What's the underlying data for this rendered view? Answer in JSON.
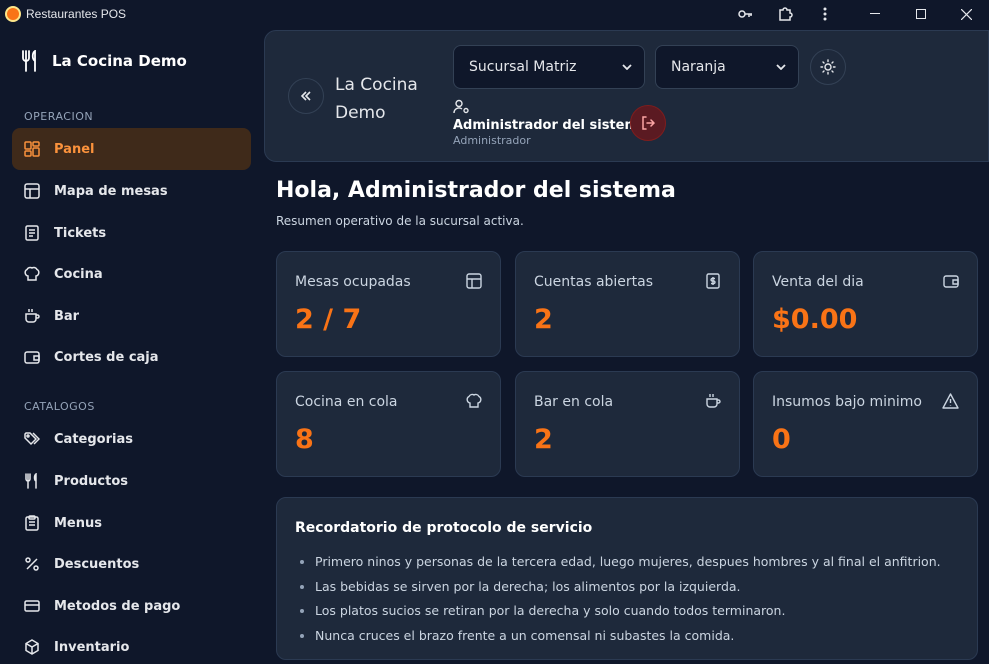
{
  "window": {
    "title": "Restaurantes POS"
  },
  "sidebar": {
    "brand": "La Cocina Demo",
    "sections": [
      {
        "label": "OPERACION",
        "items": [
          {
            "label": "Panel",
            "icon": "dashboard-icon",
            "active": true
          },
          {
            "label": "Mapa de mesas",
            "icon": "table-map-icon"
          },
          {
            "label": "Tickets",
            "icon": "ticket-icon"
          },
          {
            "label": "Cocina",
            "icon": "chef-hat-icon"
          },
          {
            "label": "Bar",
            "icon": "cup-icon"
          },
          {
            "label": "Cortes de caja",
            "icon": "wallet-icon"
          }
        ]
      },
      {
        "label": "CATALOGOS",
        "items": [
          {
            "label": "Categorias",
            "icon": "tags-icon"
          },
          {
            "label": "Productos",
            "icon": "utensils-icon"
          },
          {
            "label": "Menus",
            "icon": "clipboard-icon"
          },
          {
            "label": "Descuentos",
            "icon": "percent-icon"
          },
          {
            "label": "Metodos de pago",
            "icon": "credit-card-icon"
          },
          {
            "label": "Inventario",
            "icon": "package-icon"
          }
        ]
      }
    ]
  },
  "header": {
    "title": "La Cocina Demo",
    "branch_select": "Sucursal Matriz",
    "theme_select": "Naranja",
    "user": {
      "name": "Administrador del sistema",
      "role": "Administrador"
    }
  },
  "main": {
    "greeting": "Hola, Administrador del sistema",
    "subtitle": "Resumen operativo de la sucursal activa.",
    "stats": [
      {
        "label": "Mesas ocupadas",
        "value": "2 / 7",
        "icon": "table-icon"
      },
      {
        "label": "Cuentas abiertas",
        "value": "2",
        "icon": "receipt-dollar-icon"
      },
      {
        "label": "Venta del dia",
        "value": "$0.00",
        "icon": "wallet-icon"
      },
      {
        "label": "Cocina en cola",
        "value": "8",
        "icon": "chef-hat-icon"
      },
      {
        "label": "Bar en cola",
        "value": "2",
        "icon": "cup-icon"
      },
      {
        "label": "Insumos bajo minimo",
        "value": "0",
        "icon": "warning-icon"
      }
    ],
    "reminder": {
      "title": "Recordatorio de protocolo de servicio",
      "items": [
        "Primero ninos y personas de la tercera edad, luego mujeres, despues hombres y al final el anfitrion.",
        "Las bebidas se sirven por la derecha; los alimentos por la izquierda.",
        "Los platos sucios se retiran por la derecha y solo cuando todos terminaron.",
        "Nunca cruces el brazo frente a un comensal ni subastes la comida."
      ]
    }
  },
  "colors": {
    "accent": "#f97316",
    "background": "#0f172a",
    "card": "#1e293b"
  }
}
